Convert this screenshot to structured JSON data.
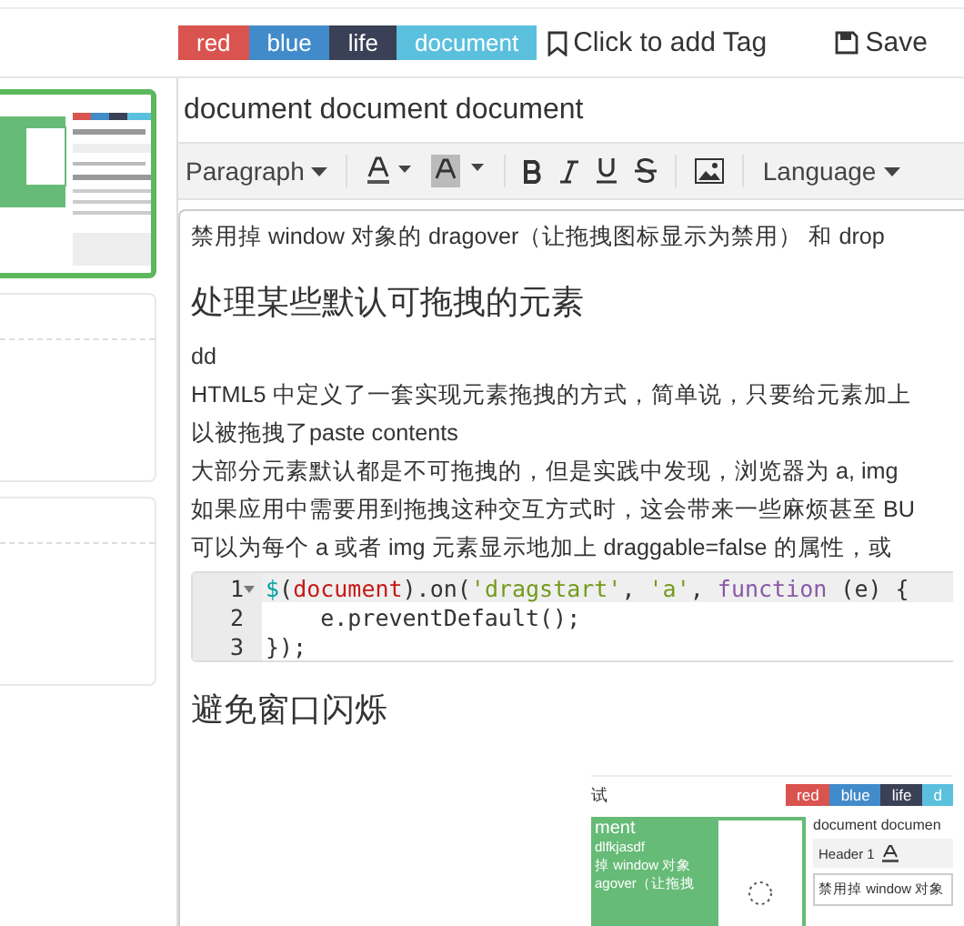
{
  "tags": [
    {
      "label": "red",
      "color": "#d9534f"
    },
    {
      "label": "blue",
      "color": "#428bca"
    },
    {
      "label": "life",
      "color": "#3a4055"
    },
    {
      "label": "document",
      "color": "#5bc0de"
    }
  ],
  "add_tag": "Click to add Tag",
  "save": "Save",
  "note_list": [
    {
      "kind": "picture",
      "selected": true
    },
    {
      "kind": "empty",
      "selected": false
    },
    {
      "kind": "empty",
      "selected": false
    }
  ],
  "title": "document document document",
  "toolbar": {
    "format": "Paragraph",
    "language": "Language"
  },
  "content": [
    {
      "kind": "p",
      "text": "禁用掉 window 对象的 dragover（让拖拽图标显示为禁用） 和 drop"
    },
    {
      "kind": "h",
      "text": "处理某些默认可拖拽的元素"
    },
    {
      "kind": "p",
      "text": "dd"
    },
    {
      "kind": "p",
      "text": "HTML5 中定义了一套实现元素拖拽的方式，简单说，只要给元素加上"
    },
    {
      "kind": "p",
      "text": "以被拖拽了paste contents"
    },
    {
      "kind": "p",
      "text": "大部分元素默认都是不可拖拽的，但是实践中发现，浏览器为 a, img"
    },
    {
      "kind": "p",
      "text": "如果应用中需要用到拖拽这种交互方式时，这会带来一些麻烦甚至 BU"
    },
    {
      "kind": "p",
      "text": "可以为每个 a 或者 img 元素显示地加上 draggable=false 的属性，或"
    },
    {
      "kind": "code",
      "lines": [
        {
          "number": "1",
          "tokens": [
            {
              "kind": "var",
              "text": "$"
            },
            {
              "kind": "plain",
              "text": "("
            },
            {
              "kind": "name",
              "text": "document"
            },
            {
              "kind": "plain",
              "text": ").on("
            },
            {
              "kind": "string",
              "text": "'dragstart'"
            },
            {
              "kind": "plain",
              "text": ", "
            },
            {
              "kind": "string",
              "text": "'a'"
            },
            {
              "kind": "plain",
              "text": ", "
            },
            {
              "kind": "keyword",
              "text": "function"
            },
            {
              "kind": "plain",
              "text": " (e) {"
            }
          ]
        },
        {
          "number": "2",
          "tokens": [
            {
              "kind": "plain",
              "text": "    e.preventDefault();"
            }
          ]
        },
        {
          "number": "3",
          "tokens": [
            {
              "kind": "plain",
              "text": "});"
            }
          ]
        }
      ]
    },
    {
      "kind": "h",
      "text": "避免窗口闪烁"
    },
    {
      "kind": "shot",
      "left_title": "试",
      "tags": [
        {
          "label": "red",
          "color": "#d9534f"
        },
        {
          "label": "blue",
          "color": "#428bca"
        },
        {
          "label": "life",
          "color": "#3a4055"
        },
        {
          "label": "d",
          "color": "#5bc0de"
        }
      ],
      "card_title": "ment",
      "card_lines": [
        "dlfkjasdf",
        "掉 window 对象",
        "agover（让拖拽"
      ],
      "title": "document documen",
      "format": "Header 1",
      "body": "禁用掉 window 对象"
    }
  ]
}
